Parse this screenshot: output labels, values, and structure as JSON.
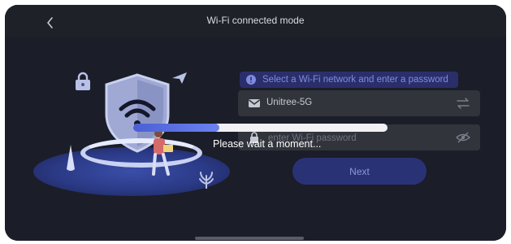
{
  "header": {
    "title": "Wi-Fi connected mode",
    "back_icon": "chevron-left-icon"
  },
  "form": {
    "hint": "Select a Wi-Fi network and enter a password",
    "hint_icon": "info-icon",
    "ssid": {
      "value": "Unitree-5G",
      "lead_icon": "mail-icon",
      "trail_icon": "swap-icon"
    },
    "password": {
      "placeholder": "enter Wi-Fi password",
      "lead_icon": "lock-icon",
      "trail_icon": "eye-off-icon"
    },
    "next_label": "Next"
  },
  "overlay": {
    "message": "Please wait a moment...",
    "progress": 0.34
  },
  "colors": {
    "accent": "#4a5fd4",
    "background": "#1b1d28",
    "button": "#2a3276"
  }
}
